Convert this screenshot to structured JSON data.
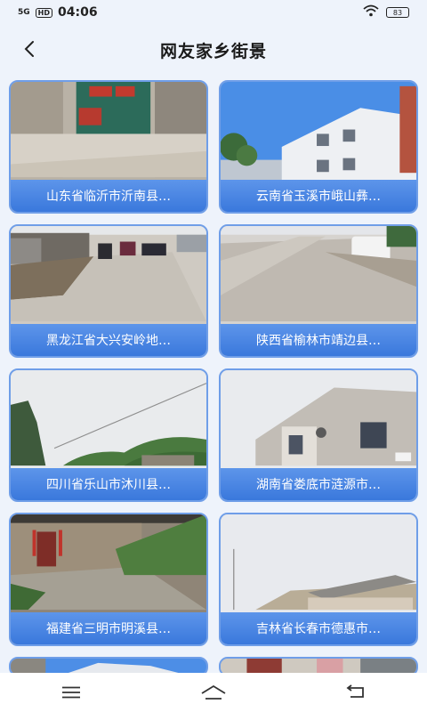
{
  "status": {
    "network": "5G",
    "hd": "HD",
    "time": "04:06",
    "battery": "83"
  },
  "header": {
    "title": "网友家乡街景"
  },
  "cards": [
    {
      "caption": "山东省临沂市沂南县…"
    },
    {
      "caption": "云南省玉溪市峨山彝…"
    },
    {
      "caption": "黑龙江省大兴安岭地…"
    },
    {
      "caption": "陕西省榆林市靖边县…"
    },
    {
      "caption": "四川省乐山市沐川县…"
    },
    {
      "caption": "湖南省娄底市涟源市…"
    },
    {
      "caption": "福建省三明市明溪县…"
    },
    {
      "caption": "吉林省长春市德惠市…"
    }
  ],
  "icons": {
    "back": "back-arrow-icon",
    "menu": "menu-icon",
    "home": "home-icon",
    "return": "return-icon",
    "wifi": "wifi-icon",
    "battery": "battery-icon"
  }
}
